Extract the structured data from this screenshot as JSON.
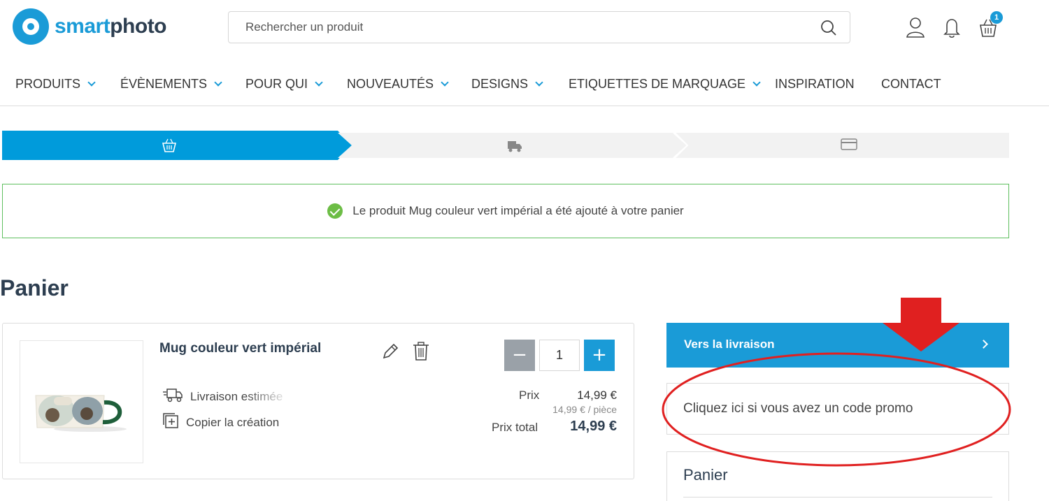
{
  "logo": {
    "part1": "smart",
    "part2": "photo"
  },
  "search": {
    "placeholder": "Rechercher un produit"
  },
  "header": {
    "cart_count": "1"
  },
  "nav": [
    "PRODUITS",
    "ÉVÈNEMENTS",
    "POUR QUI",
    "NOUVEAUTÉS",
    "DESIGNS",
    "ETIQUETTES DE MARQUAGE",
    "INSPIRATION",
    "CONTACT"
  ],
  "steps": {
    "active_index": 0,
    "icons": [
      "basket-icon",
      "delivery-truck-icon",
      "credit-card-icon"
    ]
  },
  "alert": {
    "message": "Le produit Mug couleur vert impérial a été ajouté à votre panier"
  },
  "page": {
    "title": "Panier"
  },
  "cart_item": {
    "name": "Mug couleur vert impérial",
    "quantity": "1",
    "minus_label": "−",
    "plus_label": "+",
    "delivery_text": "Livraison estimée",
    "copy_text": "Copier la création",
    "price_label": "Prix",
    "price": "14,99 €",
    "unit_price": "14,99 € / pièce",
    "total_label": "Prix total",
    "total": "14,99 €"
  },
  "sidebar": {
    "checkout_label": "Vers la livraison",
    "promo_label": "Cliquez ici si vous avez un code promo",
    "summary_title": "Panier"
  },
  "colors": {
    "brand": "#1a9bd7",
    "success": "#6cbd45",
    "annotation": "#e02020"
  }
}
